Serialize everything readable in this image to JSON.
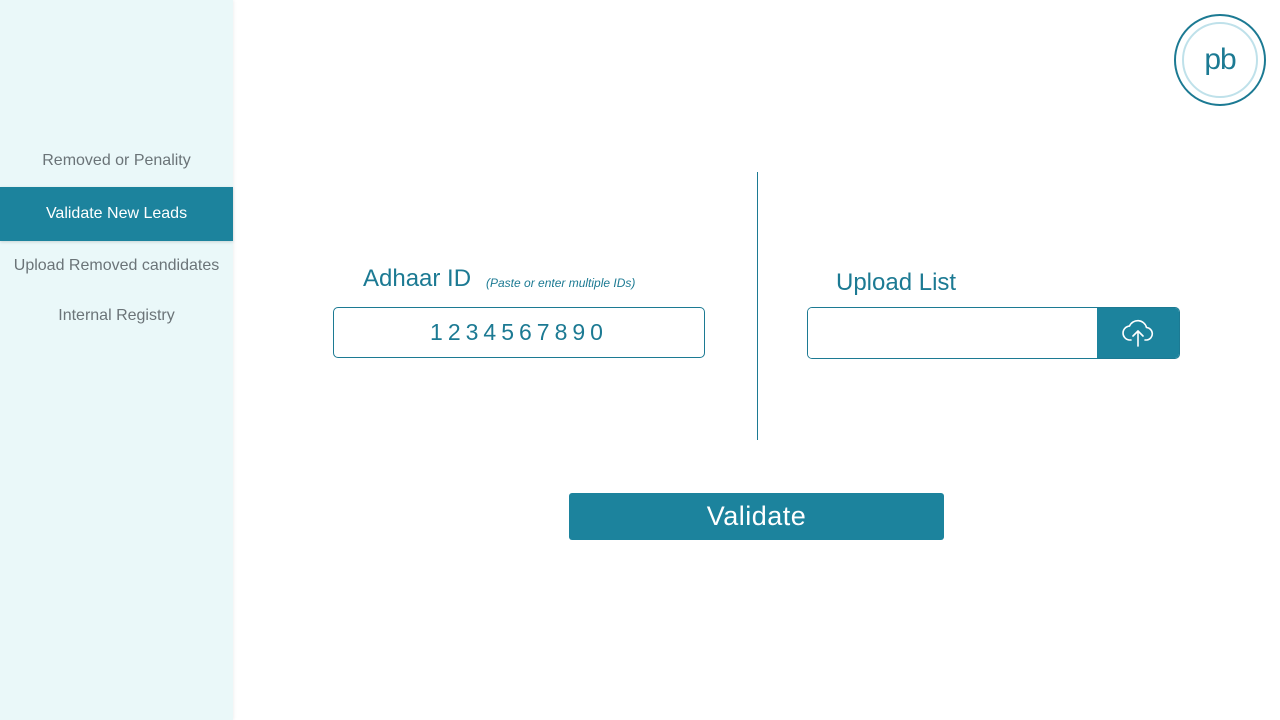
{
  "sidebar": {
    "items": [
      {
        "label": "Removed or Penality",
        "active": false
      },
      {
        "label": "Validate New Leads",
        "active": true
      },
      {
        "label": "Upload Removed candidates",
        "active": false
      },
      {
        "label": "Internal Registry",
        "active": false
      }
    ]
  },
  "logo": {
    "text": "pb"
  },
  "adhaar": {
    "label": "Adhaar ID",
    "hint": "(Paste or enter multiple IDs)",
    "value": "1234567890"
  },
  "upload": {
    "label": "Upload List",
    "value": "",
    "icon": "cloud-upload-icon"
  },
  "validate_button": {
    "label": "Validate"
  },
  "colors": {
    "accent": "#1c839d",
    "sidebar_bg": "#eaf8f9",
    "muted_text": "#6b7478"
  }
}
